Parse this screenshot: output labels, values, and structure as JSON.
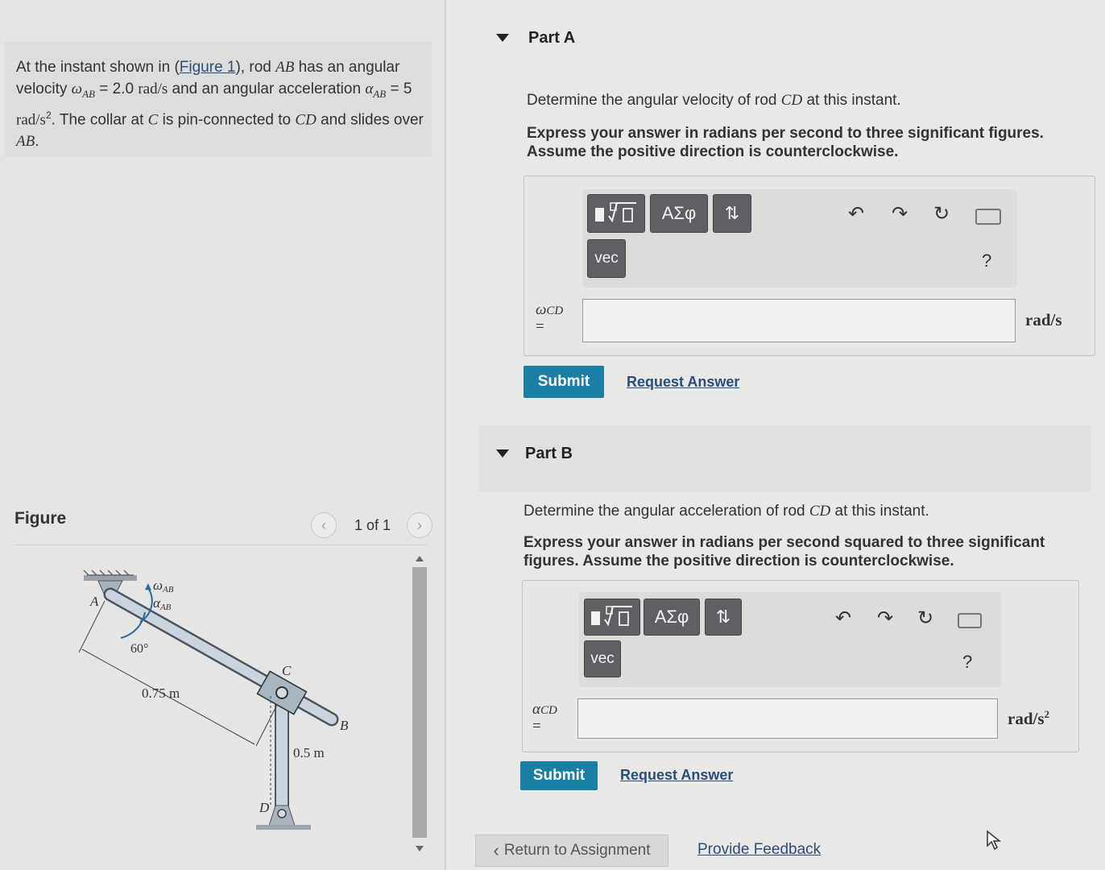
{
  "problem": {
    "t1": "At the instant shown in (",
    "figure_link": "Figure 1",
    "t2": "), rod ",
    "ab": "AB",
    "t3": " has an angular velocity ",
    "omega_ab": "ω",
    "omega_ab_sub": "AB",
    "t4": " = 2.0 ",
    "unit1": "rad/s",
    "t5": " and an angular acceleration ",
    "alpha_ab": "α",
    "alpha_ab_sub": "AB",
    "t6": " = 5 ",
    "unit2": "rad/s",
    "unit2_sup": "2",
    "t7": ". The collar at ",
    "c": "C",
    "t8": " is pin-connected to ",
    "cd": "CD",
    "t9": " and slides over ",
    "ab2": "AB",
    "t10": "."
  },
  "figure": {
    "title": "Figure",
    "pager": "1 of 1",
    "labels": {
      "A": "A",
      "B": "B",
      "C": "C",
      "D": "D",
      "omega": "ω",
      "omega_sub": "AB",
      "alpha": "α",
      "alpha_sub": "AB",
      "angle": "60°",
      "len1": "0.75 m",
      "len2": "0.5 m"
    }
  },
  "partA": {
    "title": "Part A",
    "question_pre": "Determine the angular velocity of rod ",
    "question_var": "CD",
    "question_post": " at this instant.",
    "instruction_1": "Express your answer in radians per second to three significant figures.",
    "instruction_2": "Assume the positive direction is counterclockwise.",
    "label_sym": "ω",
    "label_sub": "CD",
    "label_eq": "=",
    "unit": "rad/s",
    "input_value": "",
    "submit": "Submit",
    "request": "Request Answer"
  },
  "partB": {
    "title": "Part B",
    "question_pre": "Determine the angular acceleration of rod ",
    "question_var": "CD",
    "question_post": " at this instant.",
    "instruction_1": "Express your answer in radians per second squared to three significant",
    "instruction_2": "figures. Assume the positive direction is counterclockwise.",
    "label_sym": "α",
    "label_sub": "CD",
    "label_eq": "=",
    "unit": "rad/s",
    "unit_sup": "2",
    "input_value": "",
    "submit": "Submit",
    "request": "Request Answer"
  },
  "toolbar": {
    "templates": "templates",
    "greek": "ΑΣφ",
    "arrows": "⇅",
    "vec": "vec",
    "help": "?"
  },
  "footer": {
    "return": "Return to Assignment",
    "feedback": "Provide Feedback"
  }
}
